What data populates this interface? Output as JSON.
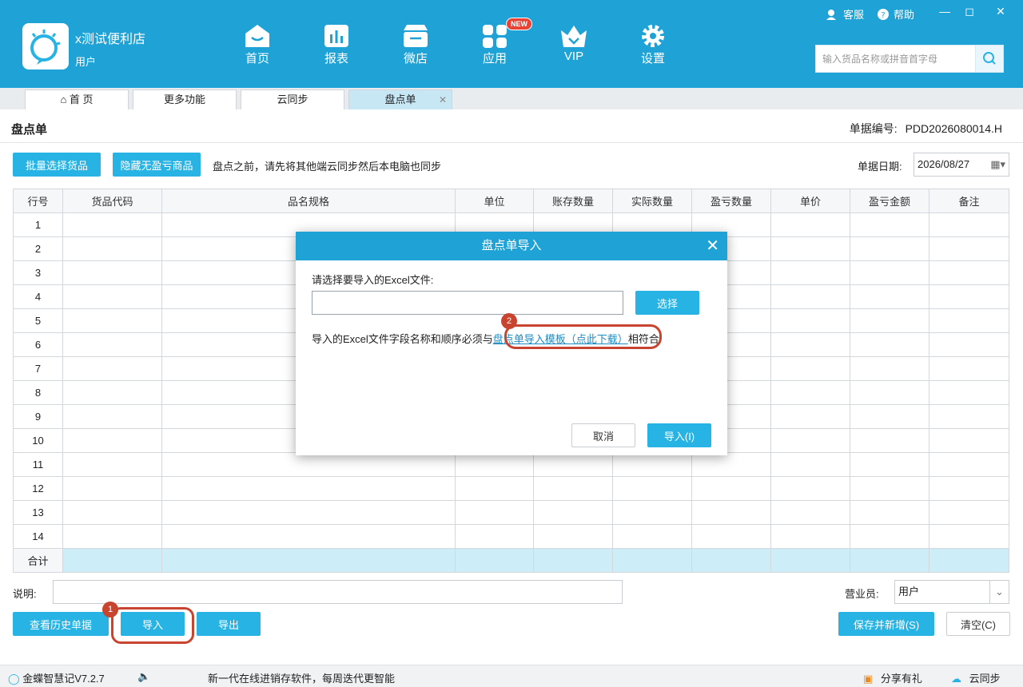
{
  "app": {
    "store_name": "x测试便利店",
    "user": "用户",
    "nav": [
      {
        "label": "首页",
        "icon": "home-icon"
      },
      {
        "label": "报表",
        "icon": "report-icon"
      },
      {
        "label": "微店",
        "icon": "shop-icon"
      },
      {
        "label": "应用",
        "icon": "apps-icon",
        "badge": "NEW"
      },
      {
        "label": "VIP",
        "icon": "vip-crown-icon"
      },
      {
        "label": "设置",
        "icon": "settings-gear-icon"
      }
    ],
    "top_links": {
      "service": "客服",
      "help": "帮助"
    },
    "search_placeholder": "输入货品名称或拼音首字母",
    "colors": {
      "primary": "#1fa2d6",
      "button": "#27b3e3",
      "callout": "#c8442f",
      "total_row": "#cdeef9"
    }
  },
  "tabs": [
    {
      "label": "首 页",
      "icon": "home-icon"
    },
    {
      "label": "更多功能"
    },
    {
      "label": "云同步"
    },
    {
      "label": "盘点单",
      "active": true
    }
  ],
  "page": {
    "title": "盘点单",
    "bill_no_label": "单据编号:",
    "bill_no": "PDD2026080014.H",
    "batch_select_btn": "批量选择货品",
    "hide_btn": "隐藏无盈亏商品",
    "notice": "盘点之前，请先将其他端云同步然后本电脑也同步",
    "date_label": "单据日期:",
    "date_value": "2026/08/27",
    "columns": [
      "行号",
      "货品代码",
      "品名规格",
      "单位",
      "账存数量",
      "实际数量",
      "盈亏数量",
      "单价",
      "盈亏金额",
      "备注"
    ],
    "row_numbers": [
      "1",
      "2",
      "3",
      "4",
      "5",
      "6",
      "7",
      "8",
      "9",
      "10",
      "11",
      "12",
      "13",
      "14"
    ],
    "total_label": "合计",
    "desc_label": "说明:",
    "sales_label": "营业员:",
    "sales_value": "用户",
    "history_btn": "查看历史单据",
    "import_btn": "导入",
    "export_btn": "导出",
    "save_new_btn": "保存并新增(S)",
    "clear_btn": "清空(C)",
    "callout_1": "1",
    "callout_2": "2"
  },
  "modal": {
    "title": "盘点单导入",
    "prompt": "请选择要导入的Excel文件:",
    "file_value": "",
    "choose_btn": "选择",
    "hint_before": "导入的Excel文件字段名称和顺序必须与",
    "template_link": "盘点单导入模板（点此下载）",
    "hint_after": "相符合",
    "cancel_btn": "取消",
    "import_btn": "导入(I)"
  },
  "status": {
    "version": "金蝶智慧记V7.2.7",
    "slogan": "新一代在线进销存软件，每周迭代更智能",
    "share": "分享有礼",
    "sync": "云同步"
  }
}
